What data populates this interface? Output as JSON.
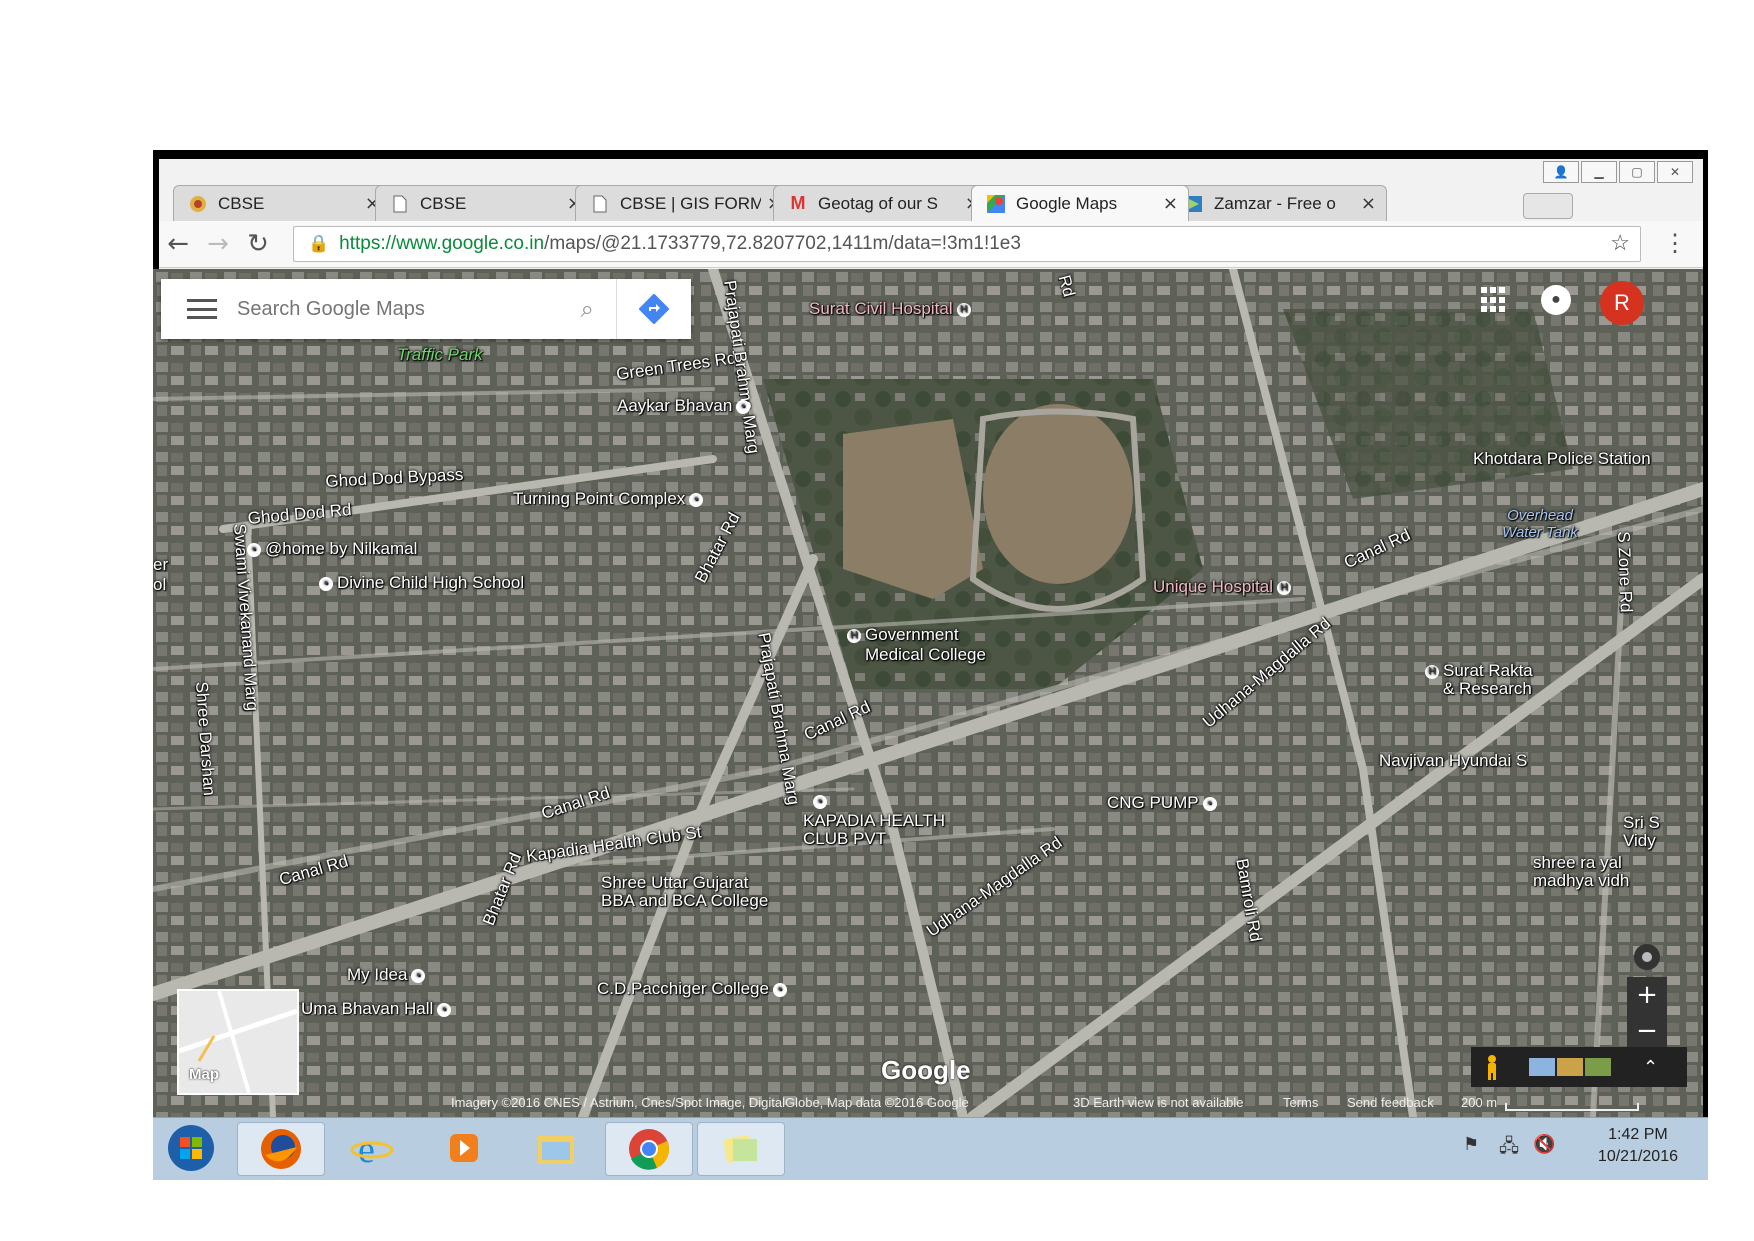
{
  "window": {
    "controls": [
      "user-icon",
      "minimize-icon",
      "maximize-icon",
      "close-icon"
    ]
  },
  "tabs": [
    {
      "title": "CBSE",
      "icon": "cbse-logo-icon",
      "active": false
    },
    {
      "title": "CBSE",
      "icon": "document-icon",
      "active": false
    },
    {
      "title": "CBSE | GIS FORM",
      "icon": "document-icon",
      "active": false
    },
    {
      "title": "Geotag of our S",
      "icon": "gmail-icon",
      "active": false
    },
    {
      "title": "Google Maps",
      "icon": "google-maps-icon",
      "active": true
    },
    {
      "title": "Zamzar - Free o",
      "icon": "zamzar-icon",
      "active": false
    }
  ],
  "toolbar": {
    "url_secure": "https://www.google.co.in",
    "url_rest": "/maps/@21.1733779,72.8207702,1411m/data=!3m1!1e3"
  },
  "search": {
    "placeholder": "Search Google Maps"
  },
  "account": {
    "avatar_letter": "R"
  },
  "map_labels": {
    "traffic_park": "Traffic Park",
    "green_trees_rd": "Green Trees Rd",
    "prajapati_top": "Prajapati Brahma Marg",
    "surat_civil": "Surat Civil Hospital",
    "aaykar": "Aaykar Bhavan",
    "ghod_dod_bypass": "Ghod Dod Bypass",
    "ghod_dod_rd": "Ghod Dod Rd",
    "turning_point": "Turning Point Complex",
    "home_nilkamal": "@home by Nilkamal",
    "divine_child": "Divine Child High School",
    "bhatar_rd_top": "Bhatar Rd",
    "swami_vivekanand": "Swami Vivekanand Marg",
    "shree_darshan": "Shree Darshan",
    "khotdara": "Khotdara Police Station",
    "overhead_water": "Overhead Water Tank",
    "canal_rd_ne": "Canal Rd",
    "unique_hospital": "Unique Hospital",
    "s_zone_rd": "S Zone Rd",
    "gmc_1": "Government",
    "gmc_2": "Medical College",
    "prajapati_mid": "Prajapati Brahma Marg",
    "canal_rd_mid": "Canal Rd",
    "udhana_magdalla_ne": "Udhana-Magdalla Rd",
    "surat_raktadan_1": "Surat Rakta",
    "surat_raktadan_2": "& Research",
    "navjivan": "Navjivan Hyundai S",
    "canal_rd_sw": "Canal Rd",
    "cng_pump": "CNG PUMP",
    "kapadia_health_1": "KAPADIA HEALTH",
    "kapadia_health_2": "CLUB PVT",
    "kapadia_st": "Kapadia Health Club St",
    "canal_rd_w": "Canal Rd",
    "bhatar_rd_bottom": "Bhatar Rd",
    "shree_uttar_1": "Shree Uttar Gujarat",
    "shree_uttar_2": "BBA and BCA College",
    "udhana_magdalla_sw": "Udhana-Magdalla Rd",
    "bamroli_rd": "Bamroli Rd",
    "sri_vid_1": "Sri S",
    "sri_vid_2": "Vidy",
    "shree_madhya_1": "shree ra     yal",
    "shree_madhya_2": "madhya    vidh",
    "my_idea": "My Idea",
    "uma_bhavan": "Uma Bhavan Hall",
    "cd_pacchigar": "C.D.Pacchiger College",
    "left_edge_1": "er",
    "left_edge_2": "ol",
    "rd_top": "Rd"
  },
  "minimap": {
    "label": "Map"
  },
  "zoom": {
    "in": "+",
    "out": "−"
  },
  "google_logo": "Google",
  "attribution": {
    "imagery": "Imagery ©2016 CNES / Astrium, Cnes/Spot Image, DigitalGlobe, Map data ©2016 Google",
    "earth_view": "3D Earth view is not available",
    "terms": "Terms",
    "feedback": "Send feedback",
    "scale": "200 m"
  },
  "taskbar": {
    "items": [
      "windows-start-icon",
      "firefox-icon",
      "internet-explorer-icon",
      "media-player-icon",
      "file-explorer-icon",
      "chrome-icon",
      "sticky-notes-icon"
    ],
    "time": "1:42 PM",
    "date": "10/21/2016"
  },
  "colors": {
    "map_base": "#5f6258",
    "road": "#b9b8b0",
    "ground_field": "#8b7d66",
    "avatar": "#d5321f",
    "taskbar": "#b9cde0",
    "secure_url": "#0a8a3a"
  }
}
